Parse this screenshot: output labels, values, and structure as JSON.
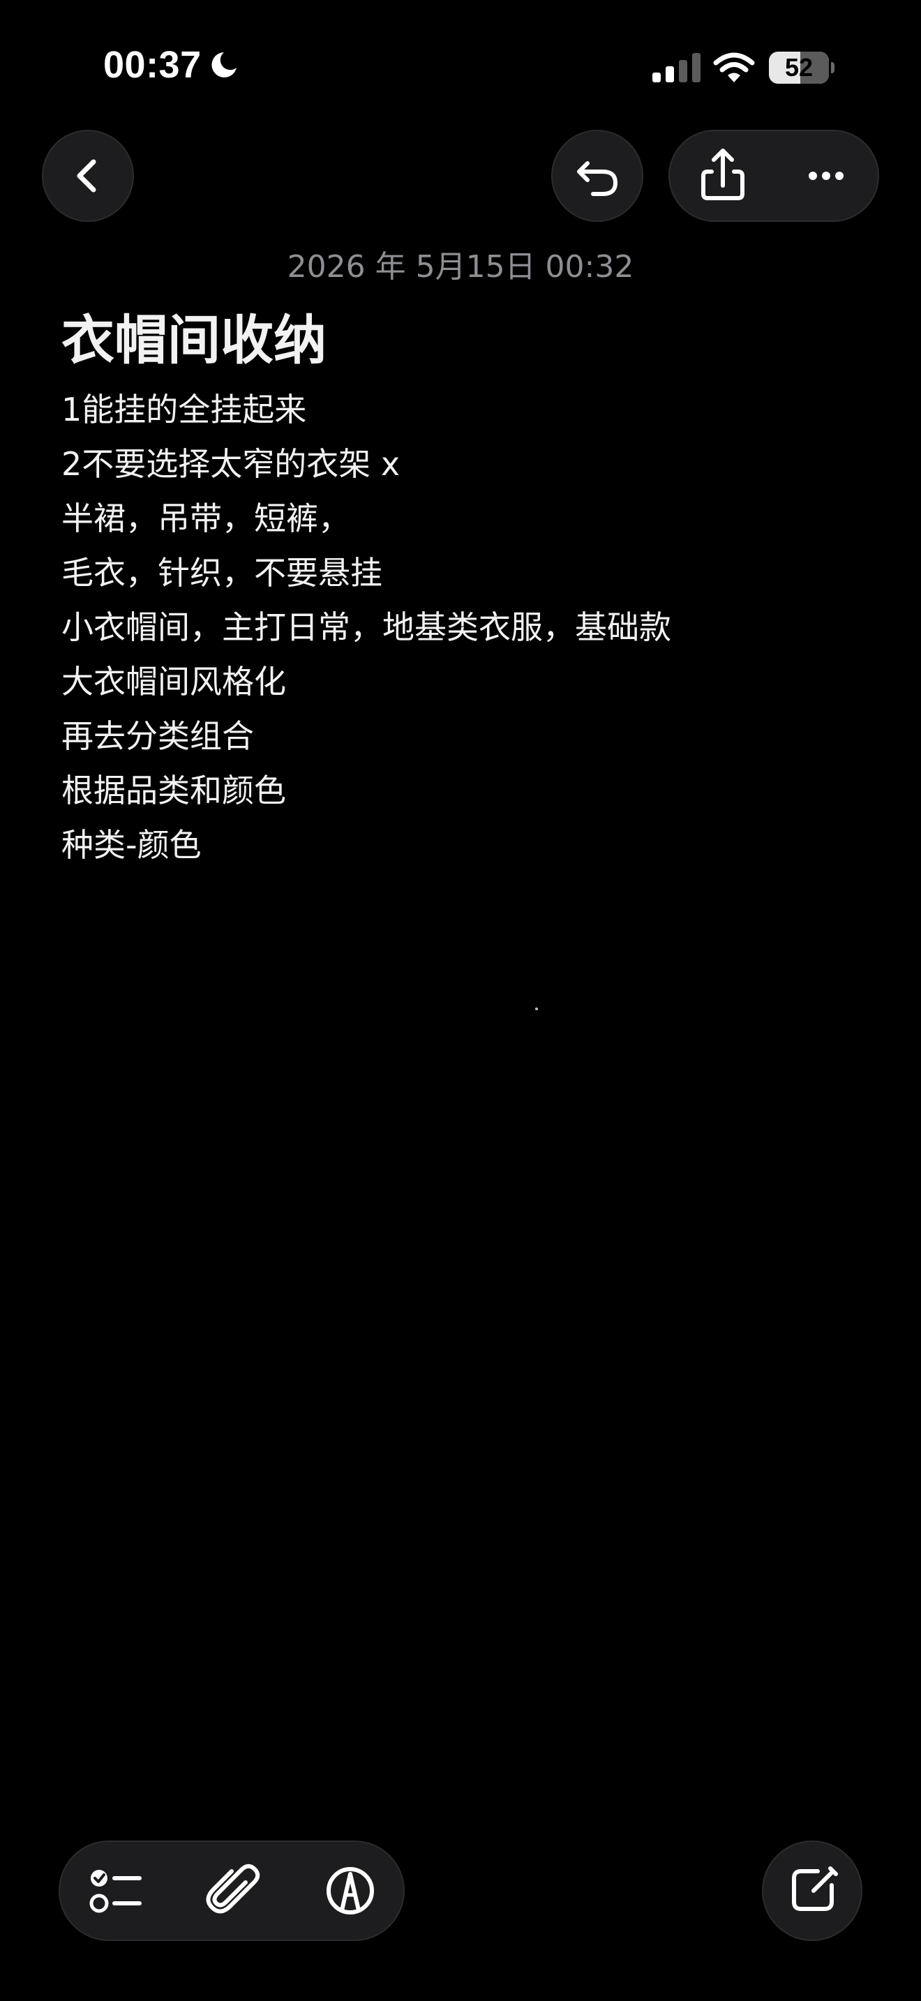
{
  "status_bar": {
    "time": "00:37",
    "focus_icon": "moon-icon",
    "signal_icon": "cellular-signal-icon",
    "wifi_icon": "wifi-icon",
    "battery_level": "52",
    "battery_fraction": 0.52
  },
  "nav": {
    "back_icon": "chevron-left-icon",
    "undo_icon": "undo-icon",
    "share_icon": "share-icon",
    "more_icon": "ellipsis-icon"
  },
  "note": {
    "date": "2026 年 5月15日 00:32",
    "title": "衣帽间收纳",
    "lines": [
      "1能挂的全挂起来",
      "2不要选择太窄的衣架 x",
      "半裙，吊带，短裤，",
      "毛衣，针织，不要悬挂",
      "小衣帽间，主打日常，地基类衣服，基础款",
      "大衣帽间风格化",
      "再去分类组合",
      "根据品类和颜色",
      "种类-颜色"
    ]
  },
  "toolbar": {
    "checklist_icon": "checklist-icon",
    "attachment_icon": "paperclip-icon",
    "markup_icon": "markup-pen-icon",
    "compose_icon": "compose-icon"
  },
  "colors": {
    "background": "#000000",
    "button_fill": "#1d1d1f",
    "button_border": "#2c2c2e",
    "date_text": "#8e8e93",
    "body_text": "#f2f2f2"
  }
}
